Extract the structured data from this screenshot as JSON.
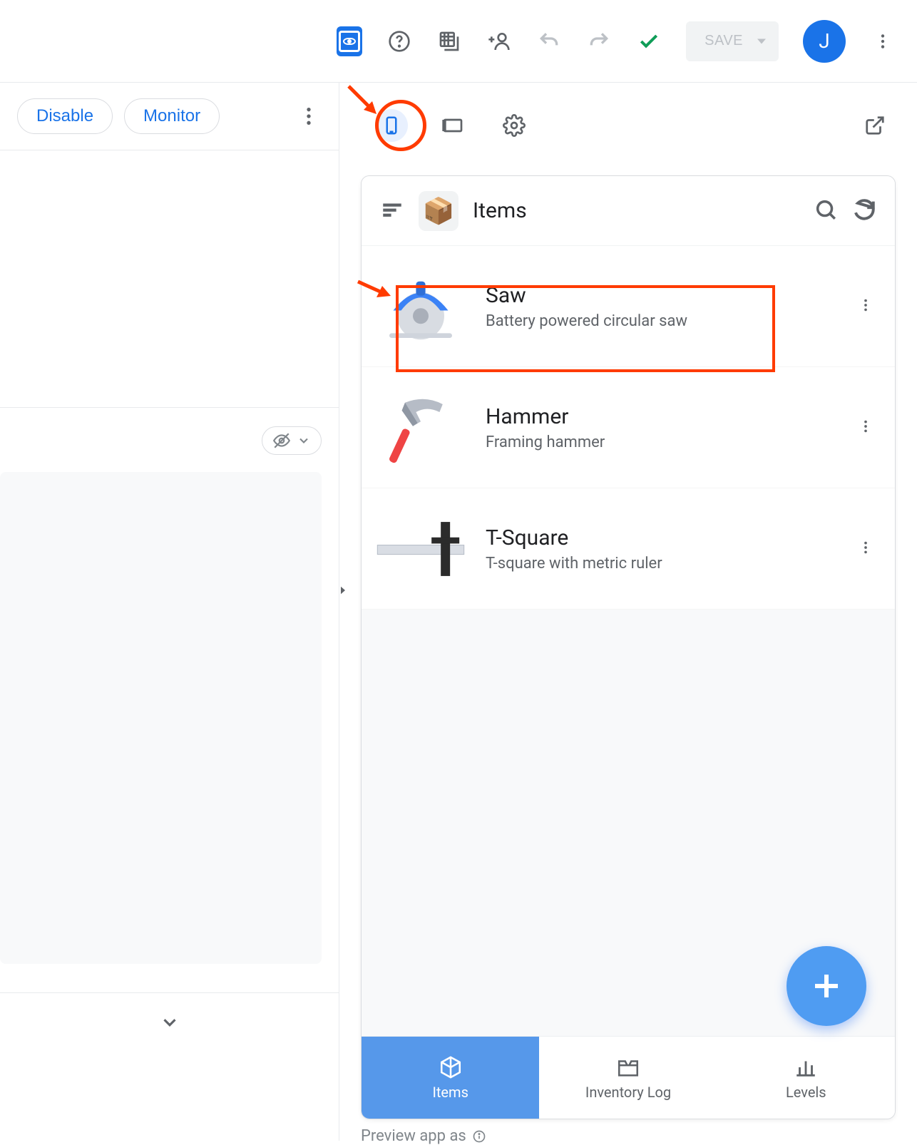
{
  "toolbar": {
    "save_label": "SAVE",
    "avatar_initial": "J"
  },
  "left_panel": {
    "disable_label": "Disable",
    "monitor_label": "Monitor"
  },
  "preview": {
    "header_title": "Items",
    "items": [
      {
        "title": "Saw",
        "subtitle": "Battery powered circular saw"
      },
      {
        "title": "Hammer",
        "subtitle": "Framing hammer"
      },
      {
        "title": "T-Square",
        "subtitle": "T-square with metric ruler"
      }
    ],
    "nav": [
      {
        "label": "Items"
      },
      {
        "label": "Inventory Log"
      },
      {
        "label": "Levels"
      }
    ],
    "footer_text": "Preview app as"
  },
  "colors": {
    "accent": "#1a73e8",
    "annotation": "#ff3b00",
    "fab": "#4f9cf2",
    "nav_active": "#5698ea"
  }
}
